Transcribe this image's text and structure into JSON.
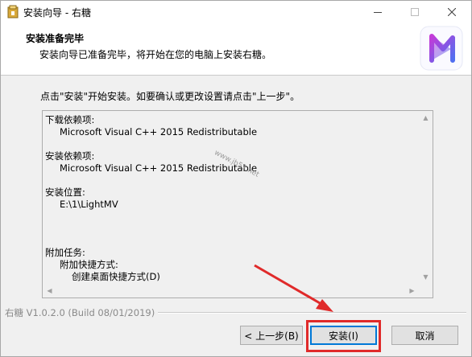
{
  "window": {
    "title": "安装向导 - 右糖",
    "controls": {
      "minimize": "—",
      "maximize": "☐",
      "close": "✕"
    }
  },
  "header": {
    "title": "安装准备完毕",
    "subtitle": "安装向导已准备完毕，将开始在您的电脑上安装右糖。"
  },
  "instruction": "点击\"安装\"开始安装。如要确认或更改设置请点击\"上一步\"。",
  "memo": {
    "lines": [
      {
        "text": "下载依赖项:",
        "indent": 0
      },
      {
        "text": "Microsoft Visual C++ 2015 Redistributable",
        "indent": 1
      },
      {
        "text": "",
        "indent": 0
      },
      {
        "text": "安装依赖项:",
        "indent": 0
      },
      {
        "text": "Microsoft Visual C++ 2015 Redistributable",
        "indent": 1
      },
      {
        "text": "",
        "indent": 0
      },
      {
        "text": "安装位置:",
        "indent": 0
      },
      {
        "text": "E:\\1\\LightMV",
        "indent": 1
      },
      {
        "text": "",
        "indent": 0
      },
      {
        "text": "",
        "indent": 0
      },
      {
        "text": "",
        "indent": 0
      },
      {
        "text": "附加任务:",
        "indent": 0
      },
      {
        "text": "附加快捷方式:",
        "indent": 1
      },
      {
        "text": "创建桌面快捷方式(D)",
        "indent": 2
      }
    ]
  },
  "watermark": "www.jb51.net",
  "version": "右糖 V1.0.2.0  (Build 08/01/2019)",
  "buttons": {
    "back": "< 上一步(B)",
    "install": "安装(I)",
    "cancel": "取消"
  },
  "colors": {
    "highlight": "#e02a2a",
    "accent": "#0078d7",
    "logo_start": "#c43bd8",
    "logo_end": "#4f6ef0"
  }
}
